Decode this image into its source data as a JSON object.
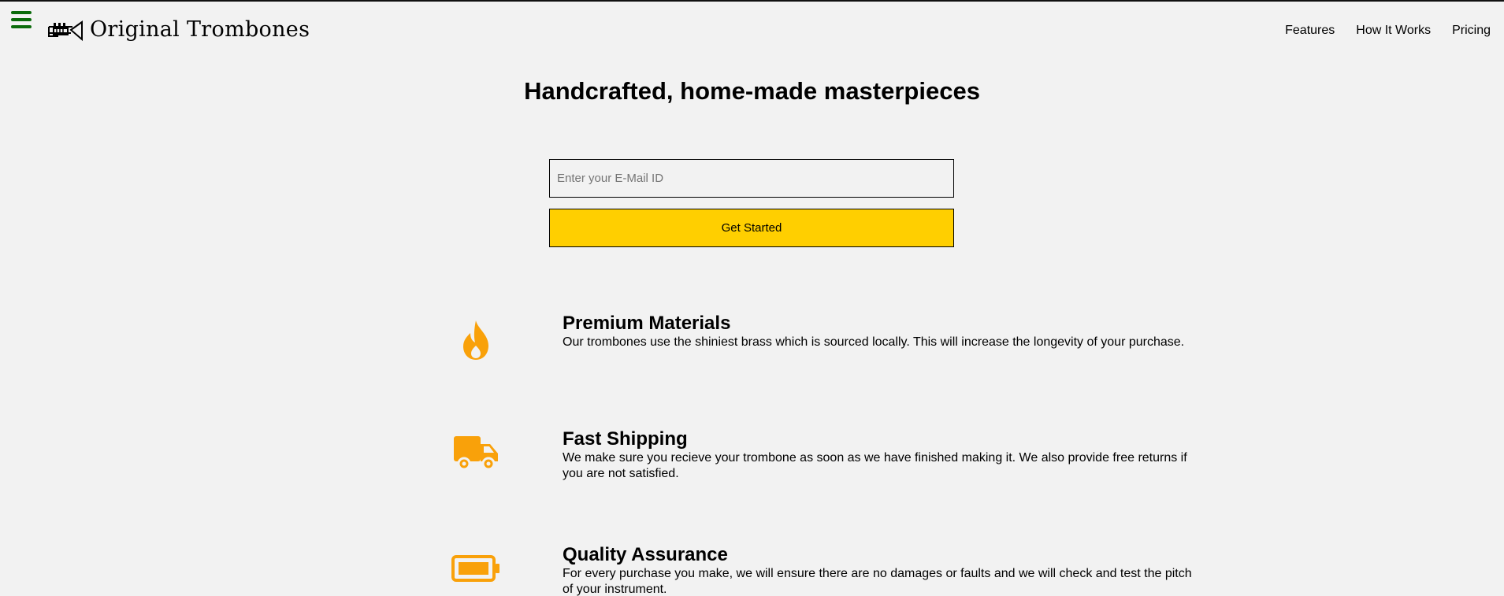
{
  "header": {
    "brand": "Original Trombones",
    "nav": [
      {
        "label": "Features"
      },
      {
        "label": "How It Works"
      },
      {
        "label": "Pricing"
      }
    ]
  },
  "hero": {
    "title": "Handcrafted, home-made masterpieces",
    "email_placeholder": "Enter your E-Mail ID",
    "email_value": "",
    "cta_label": "Get Started"
  },
  "features": [
    {
      "icon": "fire-icon",
      "title": "Premium Materials",
      "description": "Our trombones use the shiniest brass which is sourced locally. This will increase the longevity of your purchase."
    },
    {
      "icon": "truck-icon",
      "title": "Fast Shipping",
      "description": "We make sure you recieve your trombone as soon as we have finished making it. We also provide free returns if you are not satisfied."
    },
    {
      "icon": "battery-icon",
      "title": "Quality Assurance",
      "description": "For every purchase you make, we will ensure there are no damages or faults and we will check and test the pitch of your instrument."
    }
  ],
  "colors": {
    "accent": "#ffcf00",
    "icon": "#f9a10a",
    "menu": "#0b6b0b",
    "background": "#f2f2f2"
  }
}
